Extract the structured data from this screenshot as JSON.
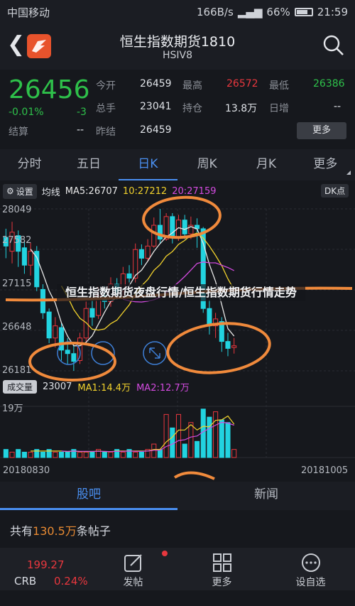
{
  "status": {
    "carrier": "中国移动",
    "speed": "166B/s",
    "battery": "66%",
    "time": "21:59"
  },
  "header": {
    "title": "恒生指数期货1810",
    "subtitle": "HSIV8"
  },
  "quote": {
    "price": "26456",
    "change_pct": "-0.01%",
    "change": "-3",
    "open_label": "今开",
    "open": "26459",
    "high_label": "最高",
    "high": "26572",
    "low_label": "最低",
    "low": "26386",
    "volume_label": "总手",
    "volume": "23041",
    "position_label": "持仓",
    "position": "13.8万",
    "daily_inc_label": "日增",
    "daily_inc": "--",
    "settle_label": "结算",
    "settle": "--",
    "prev_label": "昨结",
    "prev": "26459",
    "more_label": "更多"
  },
  "period_tabs": [
    {
      "label": "分时"
    },
    {
      "label": "五日"
    },
    {
      "label": "日K"
    },
    {
      "label": "周K"
    },
    {
      "label": "月K"
    },
    {
      "label": "更多"
    }
  ],
  "indicators": {
    "settings_label": "设置",
    "avg_label": "均线",
    "ma5": "MA5:26707",
    "ma10": "10:27212",
    "ma20": "20:27159",
    "dk_label": "DK点",
    "ma5_color": "#e8e8e8",
    "ma10_color": "#f2d22c",
    "ma20_color": "#d44be0"
  },
  "price_axis": [
    "28049",
    "27582",
    "27115",
    "26648",
    "26181"
  ],
  "volume_panel": {
    "vol_label": "成交量",
    "vol_value": "23007",
    "ma1": "MA1:14.4万",
    "ma2": "MA2:12.7万",
    "axis_top": "19万"
  },
  "date_axis": {
    "start": "20180830",
    "end": "20181005"
  },
  "overlay_text": "恒生指数期货夜盘行情/恒生指数期货行情走势",
  "content_tabs": [
    {
      "label": "股吧"
    },
    {
      "label": "新闻"
    }
  ],
  "post_count": {
    "prefix": "共有",
    "count": "130.5万",
    "suffix": "条帖子"
  },
  "toolbar": {
    "crb_price": "199.27",
    "crb_name": "CRB",
    "crb_pct": "0.24%",
    "post_label": "发帖",
    "more_label": "更多",
    "watchlist_label": "设自选"
  },
  "chart_data": {
    "type": "candlestick",
    "y_axis_ticks": [
      28049,
      27582,
      27115,
      26648,
      26181
    ],
    "ylim": [
      26181,
      28049
    ],
    "x_range": [
      "20180830",
      "20181005"
    ],
    "candles": [
      {
        "o": 27720,
        "c": 27620,
        "h": 27820,
        "l": 27480,
        "up": false
      },
      {
        "o": 27560,
        "c": 27780,
        "h": 27900,
        "l": 27420,
        "up": true
      },
      {
        "o": 27740,
        "c": 27560,
        "h": 27800,
        "l": 27380,
        "up": false
      },
      {
        "o": 27600,
        "c": 27400,
        "h": 27680,
        "l": 27300,
        "up": false
      },
      {
        "o": 27400,
        "c": 27560,
        "h": 27660,
        "l": 27280,
        "up": true
      },
      {
        "o": 27560,
        "c": 27150,
        "h": 27620,
        "l": 27100,
        "up": false
      },
      {
        "o": 27120,
        "c": 26850,
        "h": 27180,
        "l": 26780,
        "up": false
      },
      {
        "o": 26860,
        "c": 26560,
        "h": 26900,
        "l": 26500,
        "up": false
      },
      {
        "o": 26560,
        "c": 26700,
        "h": 26800,
        "l": 26450,
        "up": true
      },
      {
        "o": 26680,
        "c": 26420,
        "h": 26740,
        "l": 26300,
        "up": false
      },
      {
        "o": 26420,
        "c": 26380,
        "h": 26560,
        "l": 26250,
        "up": false
      },
      {
        "o": 26380,
        "c": 26290,
        "h": 26480,
        "l": 26181,
        "up": false
      },
      {
        "o": 26300,
        "c": 26560,
        "h": 26620,
        "l": 26260,
        "up": true
      },
      {
        "o": 26560,
        "c": 26900,
        "h": 26980,
        "l": 26520,
        "up": true
      },
      {
        "o": 26900,
        "c": 26800,
        "h": 27000,
        "l": 26700,
        "up": false
      },
      {
        "o": 26820,
        "c": 27050,
        "h": 27150,
        "l": 26780,
        "up": true
      },
      {
        "o": 27050,
        "c": 26980,
        "h": 27160,
        "l": 26900,
        "up": false
      },
      {
        "o": 26980,
        "c": 27180,
        "h": 27260,
        "l": 26920,
        "up": true
      },
      {
        "o": 27180,
        "c": 27100,
        "h": 27250,
        "l": 27000,
        "up": false
      },
      {
        "o": 27100,
        "c": 27300,
        "h": 27380,
        "l": 27050,
        "up": true
      },
      {
        "o": 27300,
        "c": 27250,
        "h": 27400,
        "l": 27200,
        "up": false
      },
      {
        "o": 27250,
        "c": 27580,
        "h": 27650,
        "l": 27200,
        "up": true
      },
      {
        "o": 27580,
        "c": 27480,
        "h": 27640,
        "l": 27400,
        "up": false
      },
      {
        "o": 27480,
        "c": 27620,
        "h": 27700,
        "l": 27450,
        "up": true
      },
      {
        "o": 27620,
        "c": 27860,
        "h": 27950,
        "l": 27600,
        "up": true
      },
      {
        "o": 27860,
        "c": 27700,
        "h": 28049,
        "l": 27650,
        "up": false
      },
      {
        "o": 27700,
        "c": 27960,
        "h": 28000,
        "l": 27680,
        "up": true
      },
      {
        "o": 27960,
        "c": 27720,
        "h": 28000,
        "l": 27650,
        "up": false
      },
      {
        "o": 27720,
        "c": 27920,
        "h": 27980,
        "l": 27680,
        "up": true
      },
      {
        "o": 27920,
        "c": 27760,
        "h": 27980,
        "l": 27700,
        "up": false
      },
      {
        "o": 27760,
        "c": 27860,
        "h": 27960,
        "l": 27700,
        "up": true
      },
      {
        "o": 27860,
        "c": 27820,
        "h": 27940,
        "l": 27600,
        "up": false
      },
      {
        "o": 27820,
        "c": 26900,
        "h": 27840,
        "l": 26850,
        "up": false
      },
      {
        "o": 26900,
        "c": 26700,
        "h": 27000,
        "l": 26600,
        "up": false
      },
      {
        "o": 26700,
        "c": 26780,
        "h": 26850,
        "l": 26560,
        "up": true
      },
      {
        "o": 26750,
        "c": 26520,
        "h": 26800,
        "l": 26400,
        "up": false
      },
      {
        "o": 26520,
        "c": 26440,
        "h": 26620,
        "l": 26350,
        "up": false
      },
      {
        "o": 26450,
        "c": 26470,
        "h": 26560,
        "l": 26380,
        "up": true
      }
    ],
    "volumes": [
      3,
      2,
      3,
      2,
      2,
      3,
      2,
      3,
      2,
      2,
      2,
      3,
      2,
      2,
      2,
      3,
      2,
      2,
      3,
      2,
      3,
      2,
      2,
      3,
      5,
      3,
      16,
      11,
      16,
      5,
      13,
      6,
      18,
      15,
      17,
      14,
      13,
      3
    ],
    "vol_up": [
      false,
      true,
      false,
      false,
      true,
      false,
      false,
      false,
      true,
      false,
      false,
      false,
      true,
      true,
      false,
      true,
      false,
      true,
      false,
      true,
      false,
      true,
      false,
      true,
      true,
      false,
      true,
      false,
      true,
      false,
      true,
      false,
      false,
      false,
      true,
      false,
      false,
      true
    ],
    "vol_axis_top": 19
  }
}
